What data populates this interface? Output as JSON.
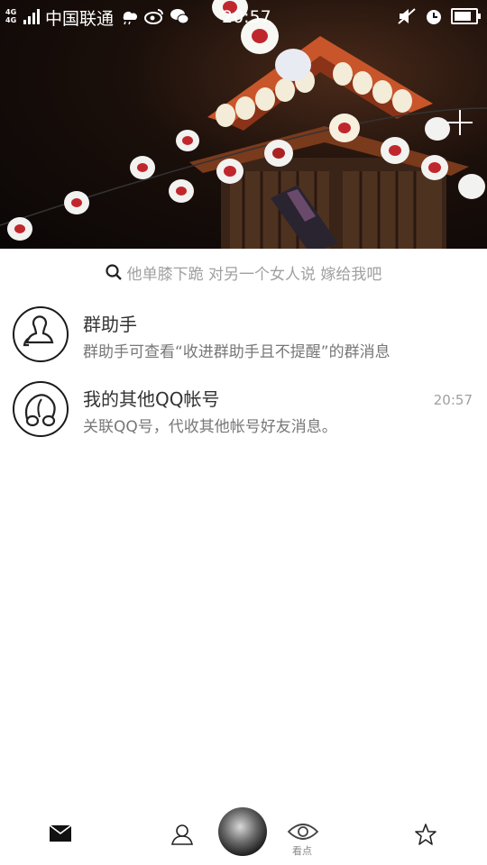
{
  "status_bar": {
    "network_top": "4G",
    "network_bottom": "4G",
    "carrier": "中国联通",
    "time": "20:57",
    "icons_left": [
      "weather-icon",
      "weibo-icon",
      "wechat-icon"
    ],
    "icons_right": [
      "mute-icon",
      "alarm-icon",
      "battery-icon"
    ]
  },
  "search": {
    "placeholder": "他单膝下跪 对另一个女人说  嫁给我吧"
  },
  "list": [
    {
      "title": "群助手",
      "subtitle": "群助手可查看“收进群助手且不提醒”的群消息",
      "time": "",
      "icon": "group-assistant-icon"
    },
    {
      "title": "我的其他QQ帐号",
      "subtitle": "关联QQ号，代收其他帐号好友消息。",
      "time": "20:57",
      "icon": "other-accounts-icon"
    }
  ],
  "bottom_nav": {
    "items": [
      {
        "icon": "message-icon",
        "label": ""
      },
      {
        "icon": "contacts-icon",
        "label": ""
      },
      {
        "icon": "profile-avatar",
        "label": ""
      },
      {
        "icon": "eye-icon",
        "label": "看点"
      },
      {
        "icon": "star-icon",
        "label": ""
      }
    ]
  },
  "colors": {
    "accent": "#1a1a1a",
    "muted_text": "#a0a0a0",
    "body_text": "#333333"
  }
}
